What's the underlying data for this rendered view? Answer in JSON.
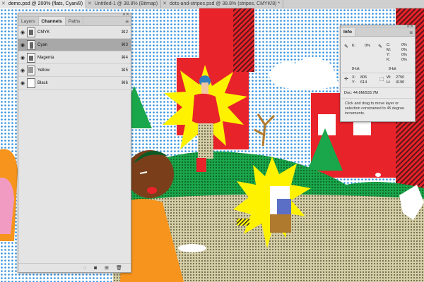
{
  "tabs": [
    {
      "label": "demo.psd @ 200% (flats, Cyan/8)",
      "active": true
    },
    {
      "label": "Untitled-1 @ 38.8% (Bitmap)",
      "active": false
    },
    {
      "label": "dots-and-stripes.psd @ 38.8% (stripes, CMYK/8) *",
      "active": false
    }
  ],
  "channels_panel": {
    "tabs": [
      "Layers",
      "Channels",
      "Paths"
    ],
    "active_tab": "Channels",
    "menu_icon": "hamburger-icon",
    "channels": [
      {
        "name": "CMYK",
        "shortcut": "⌘2",
        "selected": false
      },
      {
        "name": "Cyan",
        "shortcut": "⌘3",
        "selected": true
      },
      {
        "name": "Magenta",
        "shortcut": "⌘4",
        "selected": false
      },
      {
        "name": "Yellow",
        "shortcut": "⌘5",
        "selected": false
      },
      {
        "name": "Black",
        "shortcut": "⌘6",
        "selected": false
      }
    ],
    "footer_icons": [
      "dotted-circle-icon",
      "mask-icon",
      "new-channel-icon",
      "trash-icon"
    ]
  },
  "info_panel": {
    "tab": "Info",
    "cmyk_left": {
      "k_label": "K:",
      "k_value": "0%",
      "bit": "8-bit"
    },
    "cmyk_right": {
      "c_label": "C:",
      "c_value": "0%",
      "m_label": "M:",
      "m_value": "0%",
      "y_label": "Y:",
      "y_value": "0%",
      "k_label": "K:",
      "k_value": "0%",
      "bit": "8-bit"
    },
    "x_label": "X:",
    "x_value": "805",
    "y_label": "Y:",
    "y_value": "614",
    "w_label": "W:",
    "w_value": "2750",
    "h_label": "H:",
    "h_value": "4190",
    "doc": "Doc: 44.6M/933.7M",
    "help": "Click and drag to move layer or selection constrained to 45 degree increments."
  },
  "colors": {
    "sky": "#ffffff",
    "sky_dot": "#2f8fe0",
    "red_building": "#e8232a",
    "green_tree": "#1aa64a",
    "yellow_burst": "#fff200",
    "ground": "#c9bd8a",
    "orange": "#f7941d",
    "panel_bg": "#e4e4e4",
    "selected_row": "#a8a8a8"
  }
}
